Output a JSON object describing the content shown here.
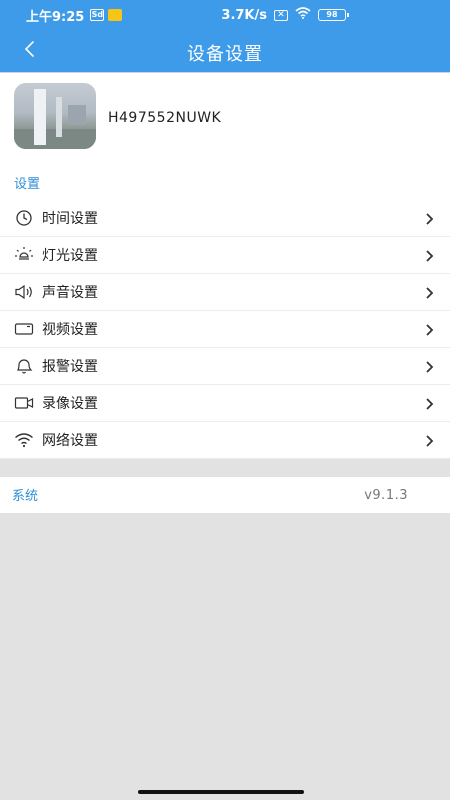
{
  "status_bar": {
    "time": "上午9:25",
    "app_icon_text": "Sd",
    "network_speed": "3.7K/s",
    "notification_icon_text": "✕",
    "battery": "98"
  },
  "header": {
    "title": "设备设置",
    "back_icon": "chevron-left-icon",
    "background_color": "#3d9be9"
  },
  "device": {
    "name": "H497552NUWK",
    "thumbnail": "camera-snapshot"
  },
  "settings_section": {
    "title": "设置",
    "accent_color": "#2f8fd8",
    "items": [
      {
        "label": "时间设置",
        "icon": "clock-icon"
      },
      {
        "label": "灯光设置",
        "icon": "light-icon"
      },
      {
        "label": "声音设置",
        "icon": "speaker-icon"
      },
      {
        "label": "视频设置",
        "icon": "video-icon"
      },
      {
        "label": "报警设置",
        "icon": "bell-icon"
      },
      {
        "label": "录像设置",
        "icon": "camera-record-icon"
      },
      {
        "label": "网络设置",
        "icon": "wifi-icon"
      }
    ]
  },
  "system_section": {
    "title": "系统",
    "version": "v9.1.3"
  }
}
